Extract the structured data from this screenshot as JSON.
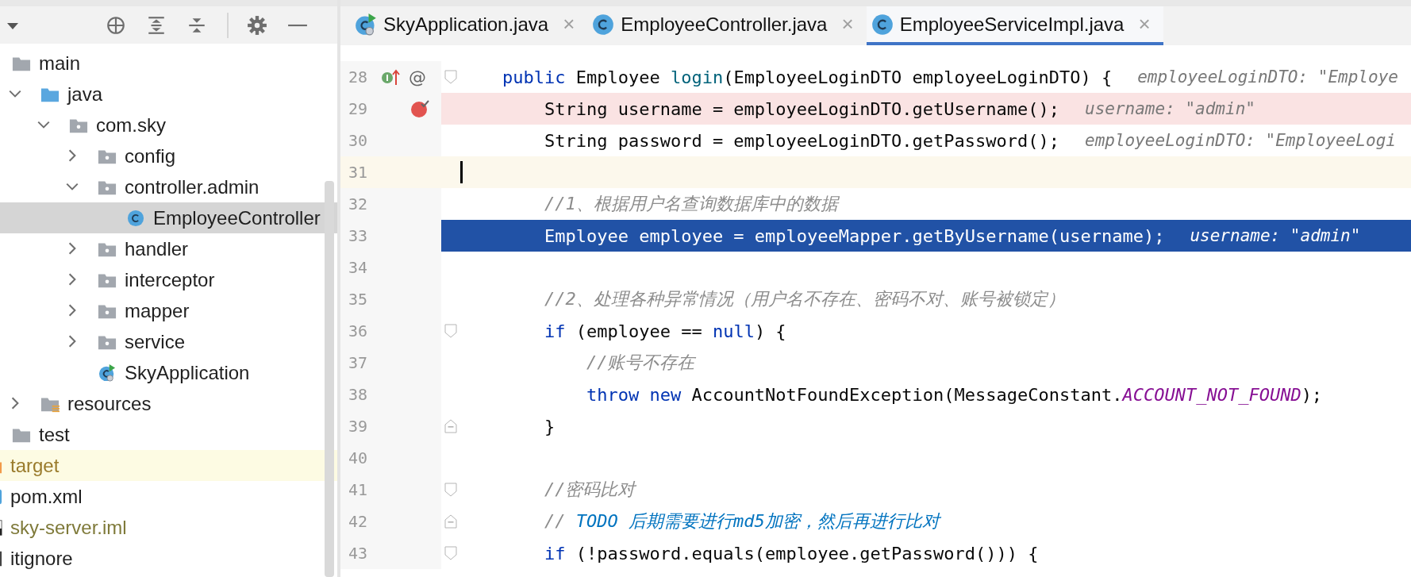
{
  "project_panel": {
    "toolbar": [
      {
        "kind": "dropdown"
      },
      {
        "kind": "locate"
      },
      {
        "kind": "expand-all"
      },
      {
        "kind": "collapse-all"
      },
      {
        "kind": "separator"
      },
      {
        "kind": "settings"
      },
      {
        "kind": "hide"
      }
    ],
    "tree": {
      "items": [
        {
          "label": "main",
          "kind": "folder",
          "selected": false,
          "color": "#1f1f1f",
          "children": [
            {
              "label": "java",
              "kind": "source-folder",
              "expanded": true,
              "selected": false,
              "color": "#1f1f1f",
              "children": [
                {
                  "label": "com.sky",
                  "kind": "package",
                  "expanded": true,
                  "selected": false,
                  "color": "#1f1f1f",
                  "children": [
                    {
                      "label": "config",
                      "kind": "package",
                      "expanded": false,
                      "selected": false,
                      "color": "#1f1f1f"
                    },
                    {
                      "label": "controller.admin",
                      "kind": "package",
                      "expanded": true,
                      "selected": false,
                      "color": "#1f1f1f",
                      "children": [
                        {
                          "label": "EmployeeController",
                          "kind": "class",
                          "selected": true,
                          "color": "#1f1f1f"
                        }
                      ]
                    },
                    {
                      "label": "handler",
                      "kind": "package",
                      "expanded": false,
                      "selected": false,
                      "color": "#1f1f1f"
                    },
                    {
                      "label": "interceptor",
                      "kind": "package",
                      "expanded": false,
                      "selected": false,
                      "color": "#1f1f1f"
                    },
                    {
                      "label": "mapper",
                      "kind": "package",
                      "expanded": false,
                      "selected": false,
                      "color": "#1f1f1f"
                    },
                    {
                      "label": "service",
                      "kind": "package",
                      "expanded": false,
                      "selected": false,
                      "color": "#1f1f1f"
                    },
                    {
                      "label": "SkyApplication",
                      "kind": "run-class",
                      "selected": false,
                      "color": "#1f1f1f"
                    }
                  ]
                }
              ]
            },
            {
              "label": "resources",
              "kind": "resources-folder",
              "expanded": false,
              "selected": false,
              "color": "#1f1f1f"
            }
          ]
        },
        {
          "label": "test",
          "kind": "folder",
          "selected": false,
          "color": "#1f1f1f"
        }
      ],
      "outer_items": [
        {
          "label": "target",
          "kind": "excluded-folder",
          "selected": false,
          "color": "#9a7b2c"
        },
        {
          "label": "pom.xml",
          "kind": "xml",
          "selected": false,
          "color": "#1f1f1f"
        },
        {
          "label": "sky-server.iml",
          "kind": "iml",
          "selected": false,
          "color": "#7f7a3a"
        },
        {
          "label": "itignore",
          "kind": "file",
          "selected": false,
          "color": "#1f1f1f"
        }
      ]
    }
  },
  "editor": {
    "tabs": [
      {
        "label": "SkyApplication.java",
        "kind": "run-class",
        "close": "×",
        "selected": false
      },
      {
        "label": "EmployeeController.java",
        "kind": "class",
        "close": "×",
        "selected": false
      },
      {
        "label": "EmployeeServiceImpl.java",
        "kind": "class",
        "close": "×",
        "selected": true
      }
    ],
    "lines": [
      {
        "number": "28",
        "kind": "normal",
        "selected": false,
        "gutter": [
          {
            "kind": "implements"
          },
          {
            "kind": "annotation",
            "glyph": "@"
          },
          {
            "kind": "fold-start"
          }
        ],
        "segments": [
          {
            "text": "    public",
            "kind": "keyword"
          },
          {
            "text": " Employee ",
            "kind": "plain"
          },
          {
            "text": "login",
            "kind": "method"
          },
          {
            "text": "(EmployeeLoginDTO employeeLoginDTO) {",
            "kind": "plain"
          }
        ],
        "hint": "employeeLoginDTO: \"Employe"
      },
      {
        "number": "29",
        "kind": "breakpoint",
        "selected": false,
        "gutter": [
          {
            "kind": "breakpoint"
          }
        ],
        "segments": [
          {
            "text": "        String username = employeeLoginDTO.getUsername();",
            "kind": "plain"
          }
        ],
        "hint": "username: \"admin\""
      },
      {
        "number": "30",
        "kind": "normal",
        "selected": false,
        "segments": [
          {
            "text": "        String password = employeeLoginDTO.getPassword();",
            "kind": "plain"
          }
        ],
        "hint": "employeeLoginDTO: \"EmployeeLogi"
      },
      {
        "number": "31",
        "kind": "current",
        "selected": false
      },
      {
        "number": "32",
        "kind": "normal",
        "selected": false,
        "segments": [
          {
            "text": "        //1、根据用户名查询数据库中的数据",
            "kind": "comment"
          }
        ]
      },
      {
        "number": "33",
        "kind": "normal",
        "selected": true,
        "segments": [
          {
            "text": "        Employee employee = employeeMapper.getByUsername(username);",
            "kind": "plain"
          }
        ],
        "hint": "username: \"admin\""
      },
      {
        "number": "34",
        "kind": "normal",
        "selected": false
      },
      {
        "number": "35",
        "kind": "normal",
        "selected": false,
        "segments": [
          {
            "text": "        //2、处理各种异常情况（用户名不存在、密码不对、账号被锁定）",
            "kind": "comment"
          }
        ]
      },
      {
        "number": "36",
        "kind": "normal",
        "selected": false,
        "gutter": [
          {
            "kind": "fold-start"
          }
        ],
        "segments": [
          {
            "text": "        if",
            "kind": "keyword"
          },
          {
            "text": " (employee == ",
            "kind": "plain"
          },
          {
            "text": "null",
            "kind": "keyword"
          },
          {
            "text": ") {",
            "kind": "plain"
          }
        ]
      },
      {
        "number": "37",
        "kind": "normal",
        "selected": false,
        "segments": [
          {
            "text": "            //账号不存在",
            "kind": "comment"
          }
        ]
      },
      {
        "number": "38",
        "kind": "normal",
        "selected": false,
        "segments": [
          {
            "text": "            throw",
            "kind": "keyword"
          },
          {
            "text": " new",
            "kind": "keyword"
          },
          {
            "text": " AccountNotFoundException(MessageConstant.",
            "kind": "plain"
          },
          {
            "text": "ACCOUNT_NOT_FOUND",
            "kind": "constant"
          },
          {
            "text": ");",
            "kind": "plain"
          }
        ]
      },
      {
        "number": "39",
        "kind": "normal",
        "selected": false,
        "gutter": [
          {
            "kind": "fold-end"
          }
        ],
        "segments": [
          {
            "text": "        }",
            "kind": "plain"
          }
        ]
      },
      {
        "number": "40",
        "kind": "normal",
        "selected": false
      },
      {
        "number": "41",
        "kind": "normal",
        "selected": false,
        "gutter": [
          {
            "kind": "fold-start"
          }
        ],
        "segments": [
          {
            "text": "        //密码比对",
            "kind": "comment"
          }
        ]
      },
      {
        "number": "42",
        "kind": "normal",
        "selected": false,
        "gutter": [
          {
            "kind": "fold-end"
          }
        ],
        "segments": [
          {
            "text": "        // ",
            "kind": "comment"
          },
          {
            "text": "TODO 后期需要进行md5加密，然后再进行比对",
            "kind": "todo"
          }
        ]
      },
      {
        "number": "43",
        "kind": "normal",
        "selected": false,
        "gutter": [
          {
            "kind": "fold-start"
          }
        ],
        "segments": [
          {
            "text": "        if",
            "kind": "keyword"
          },
          {
            "text": " (!password.equals(employee.getPassword())) {",
            "kind": "plain"
          }
        ]
      }
    ]
  }
}
